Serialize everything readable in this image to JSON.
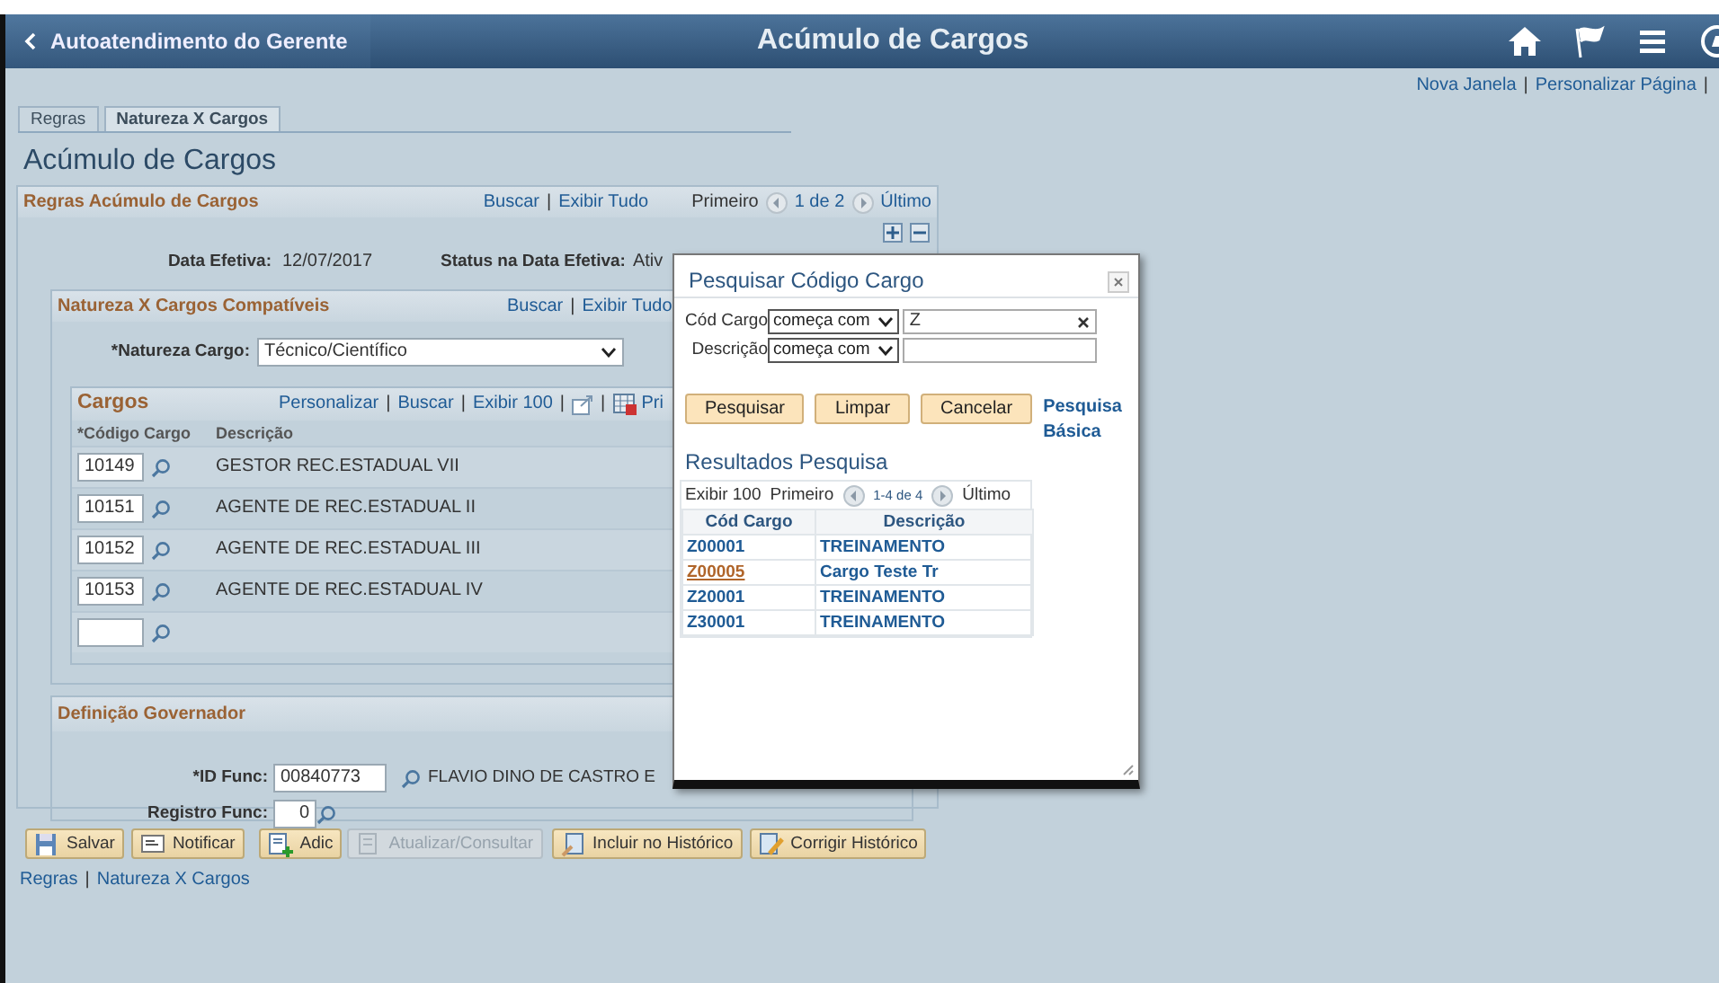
{
  "header": {
    "back_label": "Autoatendimento do Gerente",
    "title": "Acúmulo de Cargos"
  },
  "page_links": [
    {
      "kind": "link",
      "text": "Nova Janela"
    },
    {
      "kind": "separator",
      "text": "|"
    },
    {
      "kind": "link",
      "text": "Personalizar Página"
    },
    {
      "kind": "separator",
      "text": "|"
    }
  ],
  "tabs": [
    {
      "label": "Regras",
      "selected": false
    },
    {
      "label": "Natureza X Cargos",
      "selected": true
    }
  ],
  "page_title": "Acúmulo de Cargos",
  "rules_section": {
    "title": "Regras Acúmulo de Cargos",
    "links": [
      {
        "kind": "link",
        "text": "Buscar"
      },
      {
        "kind": "separator",
        "text": "|"
      },
      {
        "kind": "link",
        "text": "Exibir Tudo"
      }
    ],
    "pager": {
      "first": "Primeiro",
      "range": "1 de 2",
      "last": "Último"
    },
    "effective_date_label": "Data Efetiva:",
    "effective_date": "12/07/2017",
    "status_label": "Status na Data Efetiva:",
    "status": "Ativ"
  },
  "compat_section": {
    "title": "Natureza X Cargos Compatíveis",
    "links": [
      {
        "kind": "link",
        "text": "Buscar"
      },
      {
        "kind": "separator",
        "text": "|"
      },
      {
        "kind": "link",
        "text": "Exibir Tudo"
      }
    ],
    "nature_label": "*Natureza Cargo:",
    "nature_value": "Técnico/Científico"
  },
  "cargos_grid": {
    "title": "Cargos",
    "links": [
      {
        "kind": "link",
        "text": "Personalizar"
      },
      {
        "kind": "separator",
        "text": "|"
      },
      {
        "kind": "link",
        "text": "Buscar"
      },
      {
        "kind": "separator",
        "text": "|"
      },
      {
        "kind": "link",
        "text": "Exibir 100"
      },
      {
        "kind": "separator",
        "text": "|"
      },
      {
        "kind": "zoom"
      },
      {
        "kind": "separator",
        "text": "|"
      },
      {
        "kind": "spreadsheet"
      }
    ],
    "pager_first": "Pri",
    "columns": [
      "*Código Cargo",
      "Descrição"
    ],
    "rows": [
      {
        "kind": "entry",
        "code": "10149",
        "description": "GESTOR REC.ESTADUAL VII"
      },
      {
        "kind": "entry",
        "code": "10151",
        "description": "AGENTE DE REC.ESTADUAL II"
      },
      {
        "kind": "entry",
        "code": "10152",
        "description": "AGENTE DE REC.ESTADUAL III"
      },
      {
        "kind": "entry",
        "code": "10153",
        "description": "AGENTE DE REC.ESTADUAL IV"
      },
      {
        "kind": "blank"
      }
    ]
  },
  "governor_section": {
    "title": "Definição Governador",
    "id_label": "*ID Func:",
    "id_value": "00840773",
    "name": "FLAVIO DINO DE CASTRO E",
    "reg_label": "Registro Func:",
    "reg_value": "0"
  },
  "toolbar": [
    {
      "kind": "save",
      "label": "Salvar",
      "disabled": false
    },
    {
      "kind": "notify",
      "label": "Notificar",
      "disabled": false
    },
    {
      "kind": "add",
      "label": "Adic",
      "disabled": false
    },
    {
      "kind": "update",
      "label": "Atualizar/Consultar",
      "disabled": true
    },
    {
      "kind": "insert",
      "label": "Incluir no Histórico",
      "disabled": false
    },
    {
      "kind": "correct",
      "label": "Corrigir Histórico",
      "disabled": false
    }
  ],
  "footer_links": [
    {
      "kind": "link",
      "text": "Regras"
    },
    {
      "kind": "separator",
      "text": "|"
    },
    {
      "kind": "link",
      "text": "Natureza X Cargos"
    }
  ],
  "modal": {
    "title": "Pesquisar Código Cargo",
    "fields": [
      {
        "label": "Cód Cargo",
        "operator": "começa com",
        "value": "Z"
      },
      {
        "label": "Descrição",
        "operator": "começa com"
      }
    ],
    "buttons": [
      "Pesquisar",
      "Limpar",
      "Cancelar"
    ],
    "basic_link": "Pesquisa Básica",
    "results_title": "Resultados Pesquisa",
    "results": {
      "show": "Exibir 100",
      "first": "Primeiro",
      "range": "1-4 de 4",
      "last": "Último",
      "columns": [
        "Cód Cargo",
        "Descrição"
      ],
      "rows": [
        {
          "code": "Z00001",
          "description": "TREINAMENTO",
          "selected": false
        },
        {
          "code": "Z00005",
          "description": "Cargo Teste Tr",
          "selected": true
        },
        {
          "code": "Z20001",
          "description": "TREINAMENTO",
          "selected": false
        },
        {
          "code": "Z30001",
          "description": "TREINAMENTO",
          "selected": false
        }
      ]
    }
  }
}
